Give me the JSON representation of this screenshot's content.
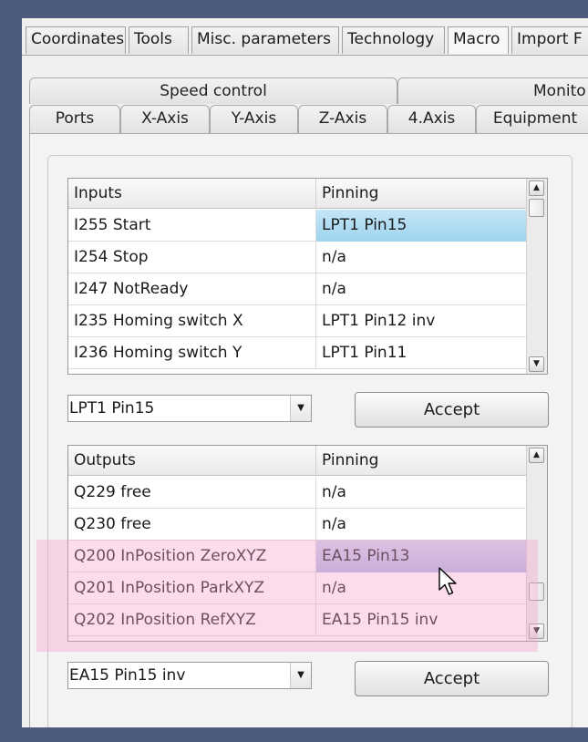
{
  "top_tabs": [
    {
      "label": "Coordinates"
    },
    {
      "label": "Tools"
    },
    {
      "label": "Misc. parameters"
    },
    {
      "label": "Technology"
    },
    {
      "label": "Macro"
    },
    {
      "label": "Import F"
    }
  ],
  "sub_tabs_row1": [
    {
      "label": "Speed control"
    },
    {
      "label": "Monito"
    }
  ],
  "sub_tabs_row2": [
    {
      "label": "Ports"
    },
    {
      "label": "X-Axis"
    },
    {
      "label": "Y-Axis"
    },
    {
      "label": "Z-Axis"
    },
    {
      "label": "4.Axis"
    },
    {
      "label": "Equipment"
    }
  ],
  "inputs_table": {
    "headers": [
      "Inputs",
      "Pinning"
    ],
    "rows": [
      {
        "name": "I255 Start",
        "pin": "LPT1 Pin15"
      },
      {
        "name": "I254 Stop",
        "pin": "n/a"
      },
      {
        "name": "I247 NotReady",
        "pin": "n/a"
      },
      {
        "name": "I235 Homing switch X",
        "pin": "LPT1 Pin12 inv"
      },
      {
        "name": "I236 Homing switch Y",
        "pin": "LPT1 Pin11"
      }
    ],
    "selected_row": 0
  },
  "inputs_combo": {
    "value": "LPT1 Pin15"
  },
  "inputs_accept": {
    "label": "Accept"
  },
  "outputs_table": {
    "headers": [
      "Outputs",
      "Pinning"
    ],
    "rows": [
      {
        "name": "Q229 free",
        "pin": "n/a"
      },
      {
        "name": "Q230 free",
        "pin": "n/a"
      },
      {
        "name": "Q200 InPosition ZeroXYZ",
        "pin": "EA15 Pin13"
      },
      {
        "name": "Q201 InPosition ParkXYZ",
        "pin": "n/a"
      },
      {
        "name": "Q202 InPosition RefXYZ",
        "pin": "EA15 Pin15 inv"
      }
    ],
    "highlighted_row": 2
  },
  "outputs_combo": {
    "value": "EA15 Pin15 inv"
  },
  "outputs_accept": {
    "label": "Accept"
  },
  "icons": {
    "combo_arrow": "dropdown-arrow-icon",
    "scroll_up": "scroll-up-icon",
    "scroll_down": "scroll-down-icon",
    "cursor": "mouse-pointer-icon"
  },
  "colors": {
    "window_frame": "#4d5b7c",
    "selection_blue": "#9ed4ee",
    "highlight_lavender": "#aeb8e0",
    "annotation_pink": "#f5a0cd"
  }
}
